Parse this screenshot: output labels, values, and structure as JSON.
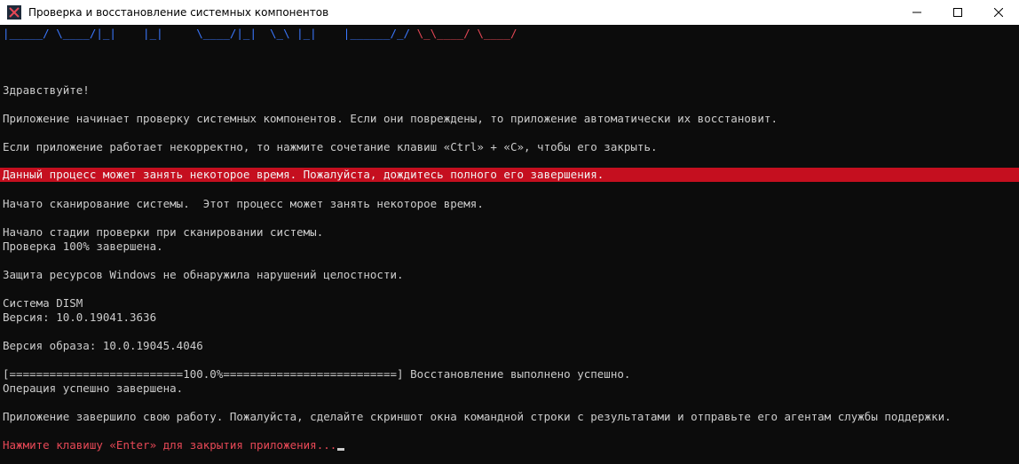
{
  "window": {
    "title": "Проверка и восстановление системных компонентов"
  },
  "console": {
    "banner_blue": "|_____/ \\____/|_|    |_|     \\____/|_|  \\_\\ |_|    |______/_/",
    "banner_red": " \\_\\____/ \\____/",
    "greeting": "Здравствуйте!",
    "intro": "Приложение начинает проверку системных компонентов. Если они повреждены, то приложение автоматически их восстановит.",
    "ctrl_hint": "Если приложение работает некорректно, то нажмите сочетание клавиш «Ctrl» + «C», чтобы его закрыть.",
    "warning": "Данный процесс может занять некоторое время. Пожалуйста, дождитесь полного его завершения.",
    "scan_started": "Начато сканирование системы.  Этот процесс может занять некоторое время.",
    "verify_stage": "Начало стадии проверки при сканировании системы.",
    "verify_done": "Проверка 100% завершена.",
    "wrp_result": "Защита ресурсов Windows не обнаружила нарушений целостности.",
    "dism_system": "Система DISM",
    "dism_version": "Версия: 10.0.19041.3636",
    "image_version": "Версия образа: 10.0.19045.4046",
    "progress_line": "[==========================100.0%==========================] Восстановление выполнено успешно.",
    "operation_done": "Операция успешно завершена.",
    "finish_msg": "Приложение завершило свою работу. Пожалуйста, сделайте скриншот окна командной строки с результатами и отправьте его агентам службы поддержки.",
    "enter_prompt": "Нажмите клавишу «Enter» для закрытия приложения..."
  },
  "icons": {
    "app": "terminal-app-icon",
    "minimize": "minimize-icon",
    "maximize": "maximize-icon",
    "close": "close-icon"
  },
  "colors": {
    "background": "#0c0c0c",
    "text": "#cccccc",
    "banner_blue": "#3b78ff",
    "banner_red": "#e74856",
    "highlight": "#c50f1f",
    "prompt": "#e74856"
  }
}
